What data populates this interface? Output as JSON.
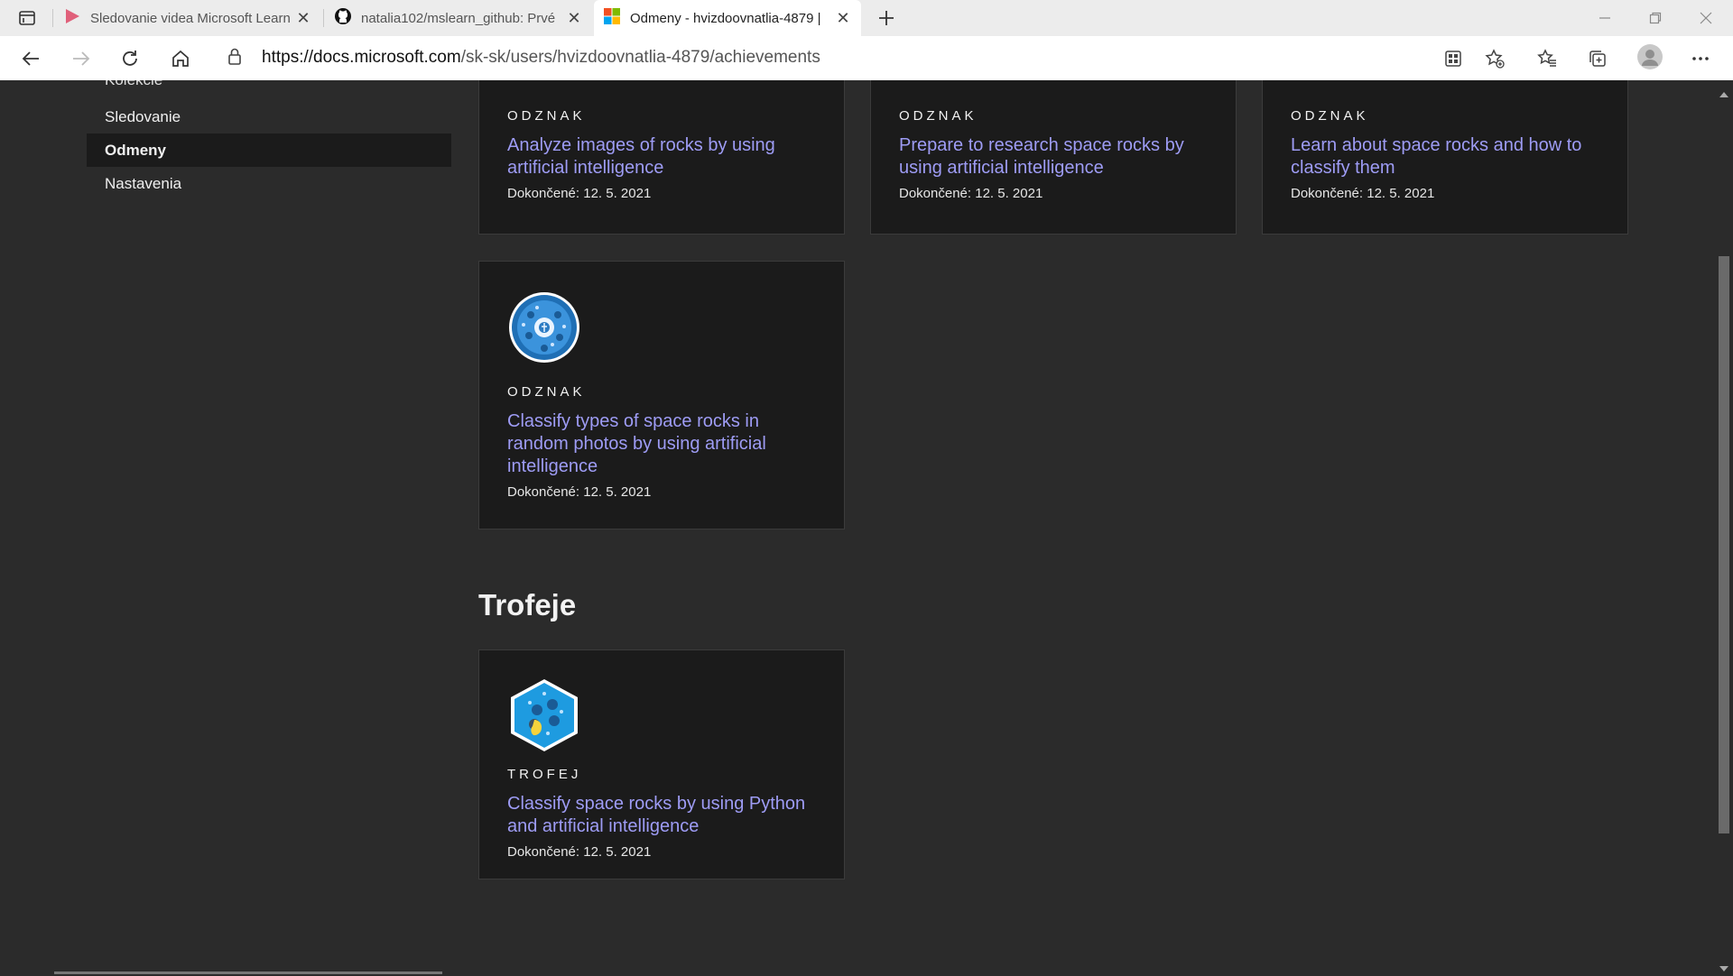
{
  "browser": {
    "tabs": [
      {
        "title": "Sledovanie videa Microsoft Learn",
        "active": false
      },
      {
        "title": "natalia102/mslearn_github: Prvé",
        "active": false
      },
      {
        "title": "Odmeny - hvizdoovnatlia-4879 |",
        "active": true
      }
    ],
    "url_domain": "https://docs.microsoft.com",
    "url_path": "/sk-sk/users/hvizdoovnatlia-4879/achievements"
  },
  "sidenav": {
    "items": [
      {
        "label": "Kolekcie",
        "active": false
      },
      {
        "label": "Sledovanie",
        "active": false
      },
      {
        "label": "Odmeny",
        "active": true
      },
      {
        "label": "Nastavenia",
        "active": false
      }
    ]
  },
  "badges": [
    {
      "kind": "ODZNAK",
      "title": "Analyze images of rocks by using artificial intelligence",
      "date": "Dokončené: 12. 5. 2021"
    },
    {
      "kind": "ODZNAK",
      "title": "Prepare to research space rocks by using artificial intelligence",
      "date": "Dokončené: 12. 5. 2021"
    },
    {
      "kind": "ODZNAK",
      "title": "Learn about space rocks and how to classify them",
      "date": "Dokončené: 12. 5. 2021"
    },
    {
      "kind": "ODZNAK",
      "title": "Classify types of space rocks in random photos by using artificial intelligence",
      "date": "Dokončené: 12. 5. 2021"
    }
  ],
  "trophies_heading": "Trofeje",
  "trophies": [
    {
      "kind": "TROFEJ",
      "title": "Classify space rocks by using Python and artificial intelligence",
      "date": "Dokončené: 12. 5. 2021"
    }
  ]
}
